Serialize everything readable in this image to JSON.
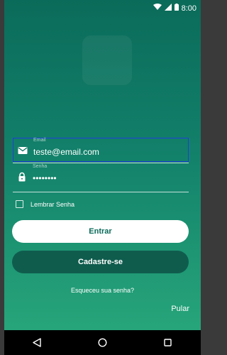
{
  "status_bar": {
    "time": "8:00",
    "icons": [
      "wifi-icon",
      "signal-icon",
      "battery-icon"
    ]
  },
  "form": {
    "email": {
      "label": "Email",
      "value": "teste@email.com",
      "icon": "mail-icon"
    },
    "password": {
      "label": "Senha",
      "value": "••••••••",
      "icon": "lock-icon"
    },
    "remember_label": "Lembrar Senha"
  },
  "buttons": {
    "entrar": "Entrar",
    "cadastre": "Cadastre-se"
  },
  "links": {
    "forgot": "Esqueceu sua senha?",
    "skip": "Pular"
  },
  "nav": {
    "buttons": [
      "back-icon",
      "home-icon",
      "recents-icon"
    ]
  },
  "colors": {
    "gradient_top": "#0b6b5a",
    "gradient_bottom": "#27a57a",
    "secondary_button": "#0f5c4d",
    "focus_outline": "#1e40d8"
  }
}
